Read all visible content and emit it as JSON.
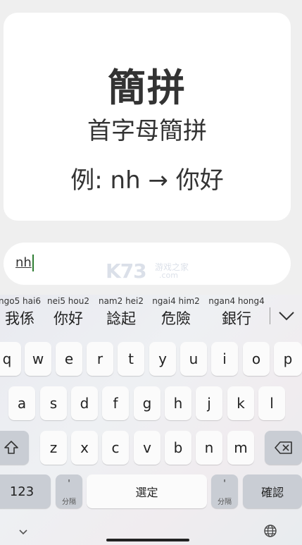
{
  "card": {
    "title": "簡拼",
    "subtitle": "首字母簡拼",
    "example": "例: nh → 你好"
  },
  "input": {
    "value": "nh"
  },
  "watermark": {
    "logo": "K73",
    "cn": "游戏之家",
    "com": ".com"
  },
  "candidates": [
    {
      "pinyin": "ngo5 hai6",
      "char": "我係"
    },
    {
      "pinyin": "nei5 hou2",
      "char": "你好"
    },
    {
      "pinyin": "nam2 hei2",
      "char": "諗起"
    },
    {
      "pinyin": "ngai4 him2",
      "char": "危險"
    },
    {
      "pinyin": "ngan4 hong4",
      "char": "銀行"
    }
  ],
  "keys": {
    "row1": [
      "q",
      "w",
      "e",
      "r",
      "t",
      "y",
      "u",
      "i",
      "o",
      "p"
    ],
    "row2": [
      "a",
      "s",
      "d",
      "f",
      "g",
      "h",
      "j",
      "k",
      "l"
    ],
    "row3": [
      "z",
      "x",
      "c",
      "v",
      "b",
      "n",
      "m"
    ],
    "num": "123",
    "apostrophe_top": "'",
    "apostrophe_sub": "分隔",
    "space": "選定",
    "confirm": "確認"
  },
  "icons": {
    "shift": "shift-icon",
    "backspace": "backspace-icon",
    "expand": "chevron-down-icon",
    "hide": "chevron-down-small-icon",
    "globe": "globe-icon"
  }
}
